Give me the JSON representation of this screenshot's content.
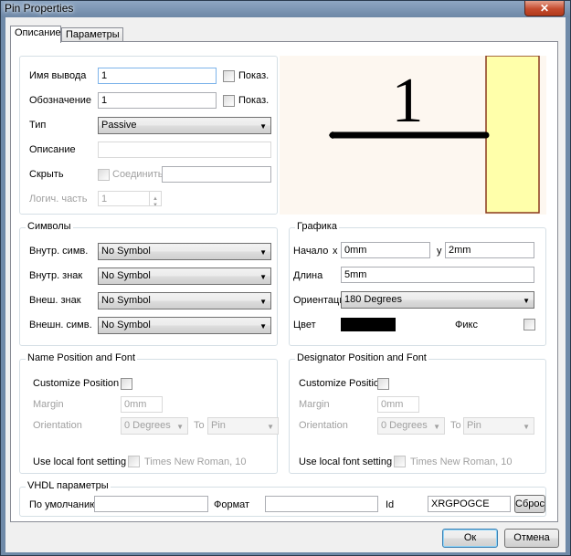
{
  "window": {
    "title": "Pin Properties",
    "close_glyph": "✕"
  },
  "tabs": [
    {
      "label": "Описание",
      "active": true
    },
    {
      "label": "Параметры",
      "active": false
    }
  ],
  "general": {
    "pin_name_label": "Имя вывода",
    "pin_name_value": "1",
    "pin_name_show": "Показ.",
    "designator_label": "Обозначение",
    "designator_value": "1",
    "designator_show": "Показ.",
    "type_label": "Тип",
    "type_value": "Passive",
    "description_label": "Описание",
    "description_value": "",
    "hide_label": "Скрыть",
    "connect_label": "Соединить",
    "connect_value": "",
    "part_label": "Логич. часть",
    "part_value": "1"
  },
  "preview": {
    "pin_number": "1",
    "pin_color": "#000000",
    "body_color": "#ffffaa",
    "body_border": "#8a3a1c"
  },
  "symbols": {
    "title": "Символы",
    "rows": [
      {
        "label": "Внутр. симв.",
        "value": "No Symbol"
      },
      {
        "label": "Внутр. знак",
        "value": "No Symbol"
      },
      {
        "label": "Внеш. знак",
        "value": "No Symbol"
      },
      {
        "label": "Внешн. симв.",
        "value": "No Symbol"
      }
    ]
  },
  "graphics": {
    "title": "Графика",
    "start_label": "Начало",
    "x_label": "x",
    "x_value": "0mm",
    "y_label": "y",
    "y_value": "2mm",
    "length_label": "Длина",
    "length_value": "5mm",
    "orientation_label": "Ориентация",
    "orientation_value": "180 Degrees",
    "color_label": "Цвет",
    "color_value": "#000000",
    "fixed_label": "Фикс"
  },
  "name_pos": {
    "title": "Name Position and Font",
    "customize_label": "Customize Position",
    "margin_label": "Margin",
    "margin_value": "0mm",
    "orientation_label": "Orientation",
    "orientation_value": "0 Degrees",
    "to_label": "To",
    "to_value": "Pin",
    "font_label": "Use local font setting",
    "font_value": "Times New Roman, 10"
  },
  "designator_pos": {
    "title": "Designator Position and Font",
    "customize_label": "Customize Position",
    "margin_label": "Margin",
    "margin_value": "0mm",
    "orientation_label": "Orientation",
    "orientation_value": "0 Degrees",
    "to_label": "To",
    "to_value": "Pin",
    "font_label": "Use local font setting",
    "font_value": "Times New Roman, 10"
  },
  "vhdl": {
    "title": "VHDL параметры",
    "default_label": "По умолчанию",
    "default_value": "",
    "format_label": "Формат",
    "format_value": "",
    "id_label": "Id",
    "id_value": "XRGPOGCE",
    "reset_label": "Сброс"
  },
  "buttons": {
    "ok": "Ок",
    "cancel": "Отмена"
  }
}
